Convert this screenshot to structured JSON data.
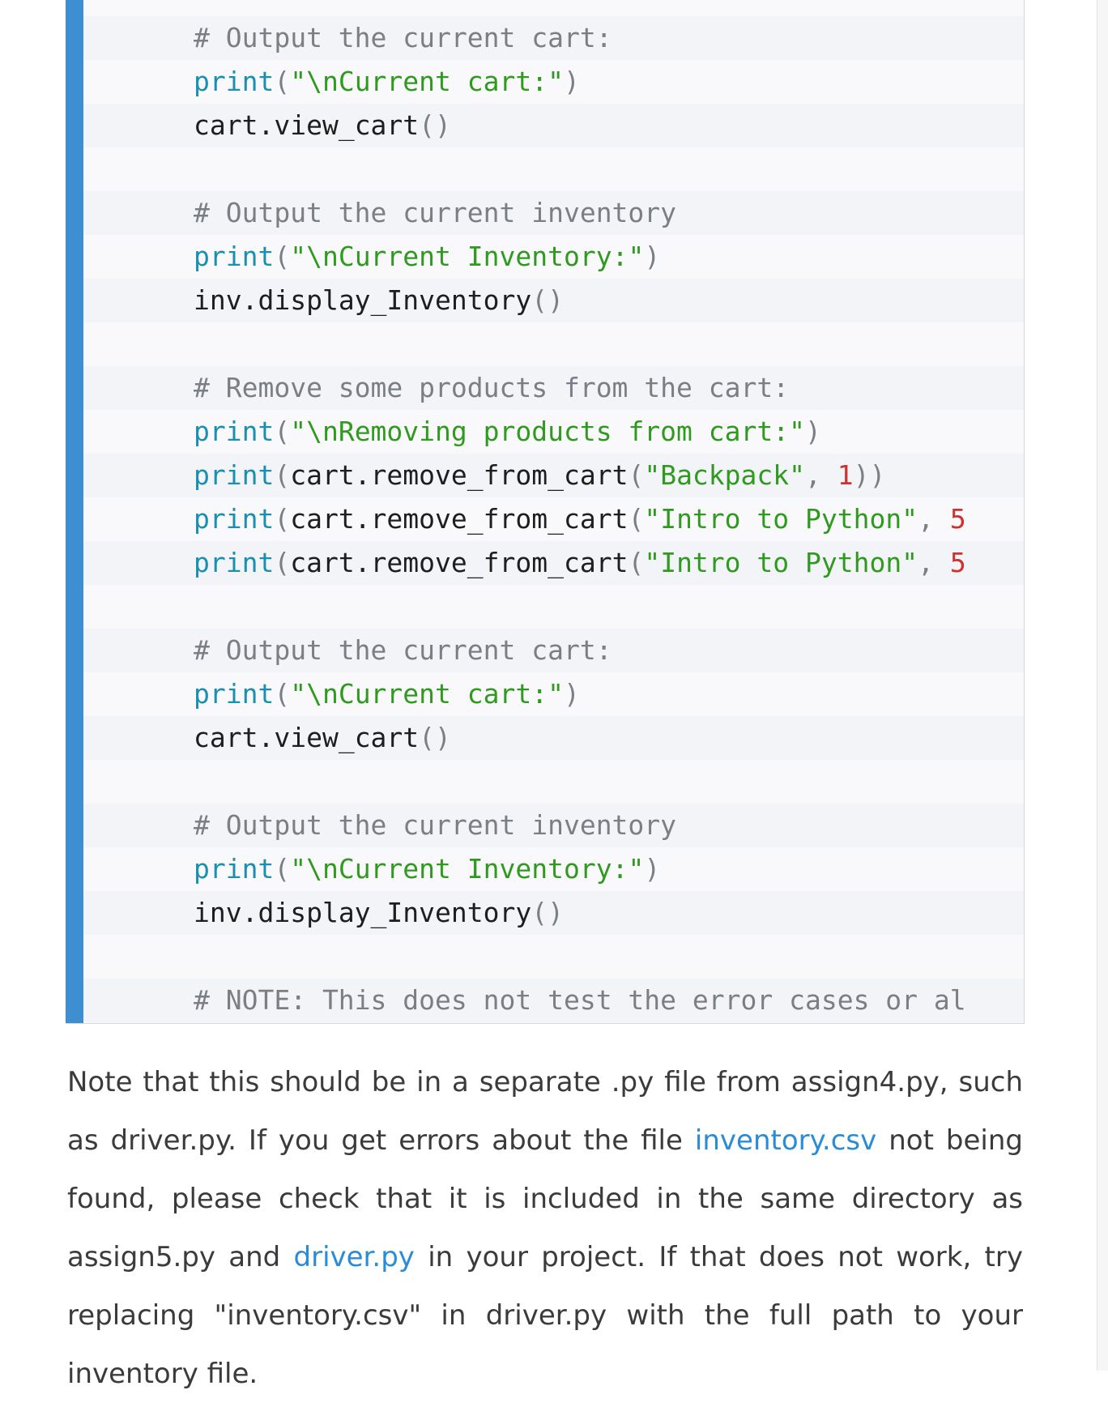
{
  "code": {
    "lines": [
      [],
      [
        [
          "comment",
          "# Output the current cart:"
        ]
      ],
      [
        [
          "builtin",
          "print"
        ],
        [
          "punct",
          "("
        ],
        [
          "string",
          "\"\\nCurrent cart:\""
        ],
        [
          "punct",
          ")"
        ]
      ],
      [
        [
          "plain",
          "cart"
        ],
        [
          "plain",
          ".view_cart"
        ],
        [
          "punct",
          "()"
        ]
      ],
      [],
      [
        [
          "comment",
          "# Output the current inventory"
        ]
      ],
      [
        [
          "builtin",
          "print"
        ],
        [
          "punct",
          "("
        ],
        [
          "string",
          "\"\\nCurrent Inventory:\""
        ],
        [
          "punct",
          ")"
        ]
      ],
      [
        [
          "plain",
          "inv"
        ],
        [
          "plain",
          ".display_Inventory"
        ],
        [
          "punct",
          "()"
        ]
      ],
      [],
      [
        [
          "comment",
          "# Remove some products from the cart:"
        ]
      ],
      [
        [
          "builtin",
          "print"
        ],
        [
          "punct",
          "("
        ],
        [
          "string",
          "\"\\nRemoving products from cart:\""
        ],
        [
          "punct",
          ")"
        ]
      ],
      [
        [
          "builtin",
          "print"
        ],
        [
          "punct",
          "("
        ],
        [
          "plain",
          "cart.remove_from_cart"
        ],
        [
          "punct",
          "("
        ],
        [
          "string",
          "\"Backpack\""
        ],
        [
          "punct",
          ", "
        ],
        [
          "number",
          "1"
        ],
        [
          "punct",
          "))"
        ]
      ],
      [
        [
          "builtin",
          "print"
        ],
        [
          "punct",
          "("
        ],
        [
          "plain",
          "cart.remove_from_cart"
        ],
        [
          "punct",
          "("
        ],
        [
          "string",
          "\"Intro to Python\""
        ],
        [
          "punct",
          ", "
        ],
        [
          "number",
          "5"
        ]
      ],
      [
        [
          "builtin",
          "print"
        ],
        [
          "punct",
          "("
        ],
        [
          "plain",
          "cart.remove_from_cart"
        ],
        [
          "punct",
          "("
        ],
        [
          "string",
          "\"Intro to Python\""
        ],
        [
          "punct",
          ", "
        ],
        [
          "number",
          "5"
        ]
      ],
      [],
      [
        [
          "comment",
          "# Output the current cart:"
        ]
      ],
      [
        [
          "builtin",
          "print"
        ],
        [
          "punct",
          "("
        ],
        [
          "string",
          "\"\\nCurrent cart:\""
        ],
        [
          "punct",
          ")"
        ]
      ],
      [
        [
          "plain",
          "cart"
        ],
        [
          "plain",
          ".view_cart"
        ],
        [
          "punct",
          "()"
        ]
      ],
      [],
      [
        [
          "comment",
          "# Output the current inventory"
        ]
      ],
      [
        [
          "builtin",
          "print"
        ],
        [
          "punct",
          "("
        ],
        [
          "string",
          "\"\\nCurrent Inventory:\""
        ],
        [
          "punct",
          ")"
        ]
      ],
      [
        [
          "plain",
          "inv"
        ],
        [
          "plain",
          ".display_Inventory"
        ],
        [
          "punct",
          "()"
        ]
      ],
      [],
      [
        [
          "comment",
          "# NOTE: This does not test the error cases or al"
        ]
      ]
    ]
  },
  "note": {
    "part1": "Note that this should be in a separate .py file from assign4.py, such as driver.py. If you get errors about the file ",
    "link1": "inventory.csv",
    "part2": " not being found, please check that it is included in the same directory as assign5.py and ",
    "link2": "driver.py",
    "part3": " in your project. If that does not work, try replacing \"inventory.csv\" in driver.py with the full path to your inventory file."
  },
  "colors": {
    "accent_bar": "#3d8fd1",
    "comment": "#7a7f86",
    "builtin": "#1b8fb0",
    "string": "#2f9a1f",
    "number": "#d0302e",
    "link": "#2a8bd6"
  }
}
